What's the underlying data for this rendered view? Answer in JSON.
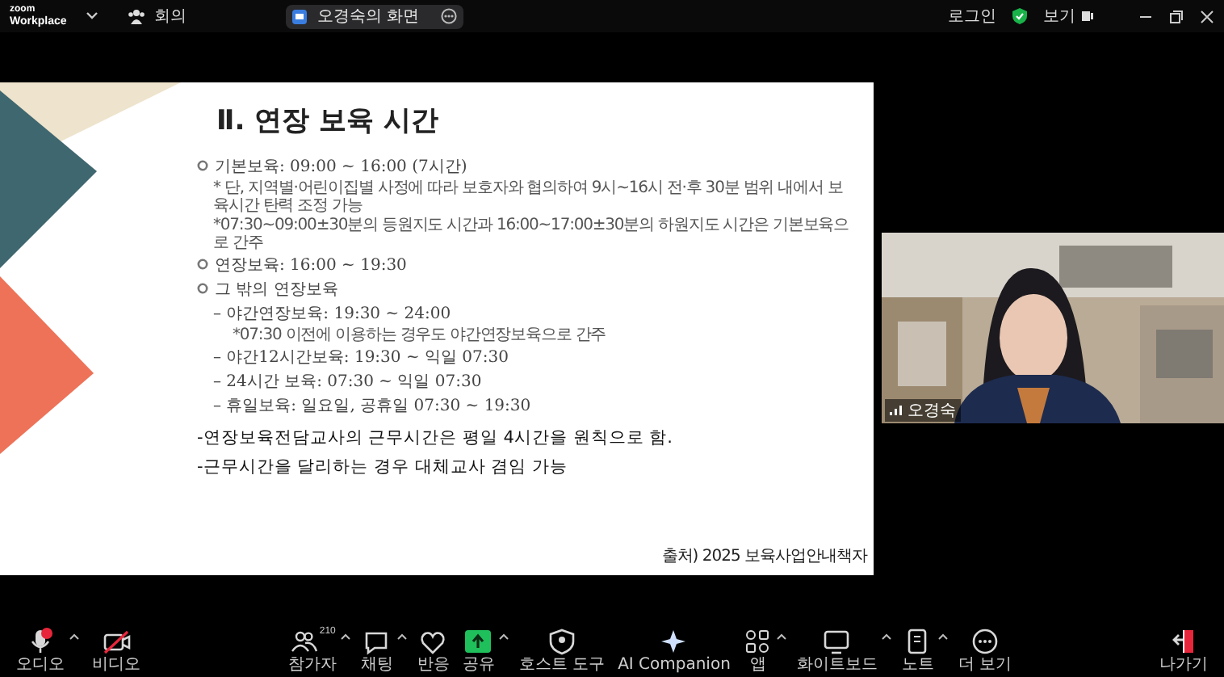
{
  "title_bar": {
    "logo_top": "zoom",
    "logo_bottom": "Workplace",
    "meeting_label": "회의",
    "share_title": "오경숙의 화면",
    "sign_in": "로그인",
    "view": "보기"
  },
  "slide": {
    "title": "Ⅱ. 연장 보육 시간",
    "items": [
      {
        "kind": "bullet",
        "text": "기본보육: 09:00 ~ 16:00 (7시간)",
        "children": [
          {
            "kind": "note",
            "text": "* 단, 지역별·어린이집별 사정에 따라 보호자와 협의하여  9시~16시 전·후 30분 범위 내에서 보육시간 탄력 조정 가능"
          },
          {
            "kind": "note",
            "text": "*07:30~09:00±30분의 등원지도 시간과 16:00~17:00±30분의 하원지도 시간은 기본보육으로 간주"
          }
        ]
      },
      {
        "kind": "bullet",
        "text": "연장보육: 16:00 ~ 19:30"
      },
      {
        "kind": "bullet",
        "text": "그 밖의 연장보육",
        "children": [
          {
            "kind": "dash",
            "text": "– 야간연장보육: 19:30 ~ 24:00",
            "children": [
              {
                "kind": "note",
                "text": "*07:30 이전에 이용하는 경우도 야간연장보육으로 간주"
              }
            ]
          },
          {
            "kind": "dash",
            "text": "– 야간12시간보육: 19:30 ~ 익일 07:30"
          },
          {
            "kind": "dash",
            "text": "– 24시간 보육: 07:30 ~ 익일 07:30"
          },
          {
            "kind": "dash",
            "text": "– 휴일보육: 일요일, 공휴일 07:30 ~ 19:30"
          }
        ]
      }
    ],
    "statements": [
      "-연장보육전담교사의 근무시간은 평일 4시간을 원칙으로 함.",
      "-근무시간을 달리하는 경우 대체교사 겸임 가능"
    ],
    "source": "출처) 2025 보육사업안내책자"
  },
  "video": {
    "name": "오경숙"
  },
  "toolbar": {
    "left": [
      {
        "kind": "audio",
        "label": "오디오",
        "off": true,
        "caret": true
      },
      {
        "kind": "video",
        "label": "비디오",
        "off": true,
        "caret": false
      }
    ],
    "center": [
      {
        "kind": "participants",
        "label": "참가자",
        "count": "210",
        "caret": true
      },
      {
        "kind": "chat",
        "label": "채팅",
        "caret": true
      },
      {
        "kind": "react",
        "label": "반응",
        "caret": false
      },
      {
        "kind": "share",
        "label": "공유",
        "caret": true
      },
      {
        "kind": "host",
        "label": "호스트 도구",
        "caret": false
      },
      {
        "kind": "ai",
        "label": "AI Companion",
        "caret": false
      },
      {
        "kind": "apps",
        "label": "앱",
        "caret": true
      },
      {
        "kind": "whiteboard",
        "label": "화이트보드",
        "caret": true
      },
      {
        "kind": "notes",
        "label": "노트",
        "caret": true
      },
      {
        "kind": "more",
        "label": "더 보기",
        "caret": false
      }
    ],
    "right": [
      {
        "kind": "leave",
        "label": "나가기",
        "caret": false
      }
    ]
  }
}
